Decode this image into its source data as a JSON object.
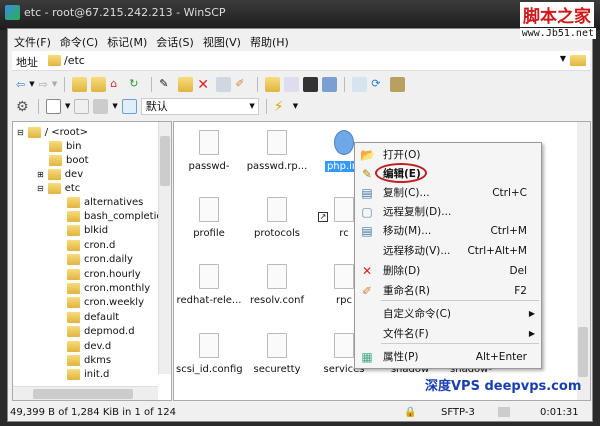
{
  "window": {
    "title": "etc - root@67.215.242.213 - WinSCP"
  },
  "watermark": {
    "logo": "脚本之家",
    "url": "www.Jb51.net",
    "footer": "深度VPS deepvps.com"
  },
  "menubar": [
    "文件(F)",
    "命令(C)",
    "标记(M)",
    "会话(S)",
    "视图(V)",
    "帮助(H)"
  ],
  "address": {
    "label": "地址",
    "path": "/etc"
  },
  "toolbar2": {
    "profile": "默认"
  },
  "tree": {
    "root": "/ <root>",
    "items": [
      "bin",
      "boot",
      "dev",
      "etc"
    ],
    "etc_children": [
      "alternatives",
      "bash_completion",
      "blkid",
      "cron.d",
      "cron.daily",
      "cron.hourly",
      "cron.monthly",
      "cron.weekly",
      "default",
      "depmod.d",
      "dev.d",
      "dkms",
      "init.d"
    ]
  },
  "files": [
    [
      "passwd-",
      "passwd.rp...",
      "php.ini"
    ],
    [
      "profile",
      "protocols",
      "rc"
    ],
    [
      "redhat-rele...",
      "resolv.conf",
      "rpc"
    ],
    [
      "scsi_id.config",
      "securetty",
      "services",
      "shadow",
      "shadow-"
    ]
  ],
  "context_menu": [
    {
      "label": "打开(O)",
      "shortcut": ""
    },
    {
      "label": "编辑(E)",
      "shortcut": ""
    },
    {
      "label": "复制(C)...",
      "shortcut": "Ctrl+C"
    },
    {
      "label": "远程复制(D)...",
      "shortcut": ""
    },
    {
      "label": "移动(M)...",
      "shortcut": "Ctrl+M"
    },
    {
      "label": "远程移动(V)...",
      "shortcut": "Ctrl+Alt+M"
    },
    {
      "label": "删除(D)",
      "shortcut": "Del"
    },
    {
      "label": "重命名(R)",
      "shortcut": "F2"
    },
    {
      "label": "自定义命令(C)",
      "shortcut": ""
    },
    {
      "label": "文件名(F)",
      "shortcut": ""
    },
    {
      "label": "属性(P)",
      "shortcut": "Alt+Enter"
    }
  ],
  "status": {
    "selection": "49,399 B of 1,284 KiB in 1 of 124",
    "protocol": "SFTP-3",
    "time": "0:01:31"
  }
}
